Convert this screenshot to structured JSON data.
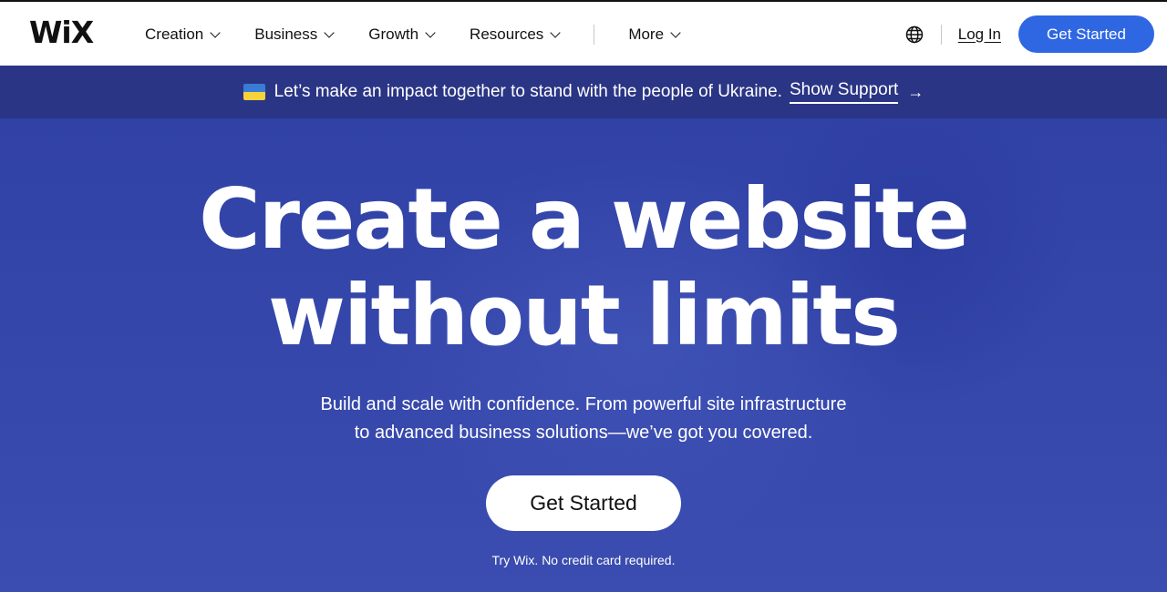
{
  "header": {
    "logo_text": "WiX",
    "nav": [
      {
        "label": "Creation",
        "has_dropdown": true
      },
      {
        "label": "Business",
        "has_dropdown": true
      },
      {
        "label": "Growth",
        "has_dropdown": true
      },
      {
        "label": "Resources",
        "has_dropdown": true
      },
      {
        "label": "More",
        "has_dropdown": true
      }
    ],
    "language_icon": "globe-icon",
    "login_label": "Log In",
    "get_started_label": "Get Started",
    "accent_color": "#2f67e3"
  },
  "banner": {
    "flag_icon": "ukraine-flag-icon",
    "text": "Let’s make an impact together to stand with the people of Ukraine.",
    "link_label": "Show Support",
    "arrow": "→",
    "background_color": "#2b3585"
  },
  "hero": {
    "headline_line1": "Create a website",
    "headline_line2": "without limits",
    "subtext_line1": "Build and scale with confidence. From powerful site infrastructure",
    "subtext_line2": "to advanced business solutions—we’ve got you covered.",
    "cta_label": "Get Started",
    "note": "Try Wix. No credit card required.",
    "background_color": "#3445aa"
  }
}
